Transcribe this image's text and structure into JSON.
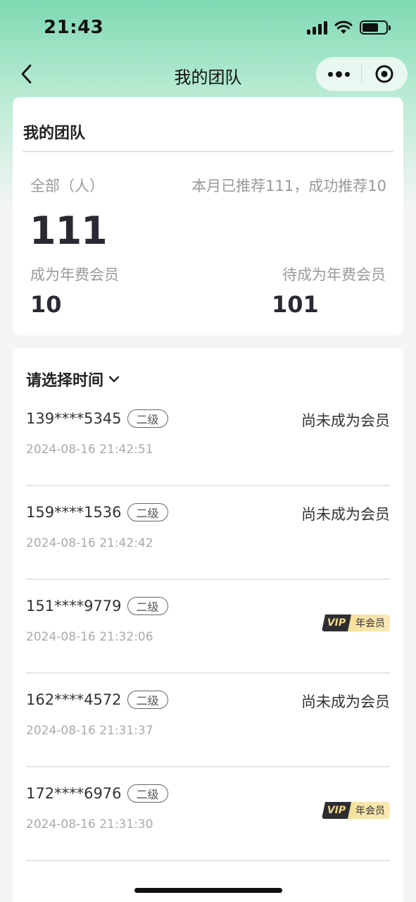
{
  "status_bar": {
    "time": "21:43"
  },
  "nav": {
    "title": "我的团队"
  },
  "summary": {
    "title": "我的团队",
    "all_label": "全部（人）",
    "month_text": "本月已推荐111，成功推荐10",
    "total": "111",
    "member_label": "成为年费会员",
    "member_count": "10",
    "pending_label": "待成为年费会员",
    "pending_count": "101"
  },
  "list": {
    "filter_label": "请选择时间",
    "rows": [
      {
        "phone": "139****5345",
        "level": "二级",
        "date": "2024-08-16 21:42:51",
        "status": "尚未成为会员",
        "vip": false
      },
      {
        "phone": "159****1536",
        "level": "二级",
        "date": "2024-08-16 21:42:42",
        "status": "尚未成为会员",
        "vip": false
      },
      {
        "phone": "151****9779",
        "level": "二级",
        "date": "2024-08-16 21:32:06",
        "status": "",
        "vip": true
      },
      {
        "phone": "162****4572",
        "level": "二级",
        "date": "2024-08-16 21:31:37",
        "status": "尚未成为会员",
        "vip": false
      },
      {
        "phone": "172****6976",
        "level": "二级",
        "date": "2024-08-16 21:31:30",
        "status": "",
        "vip": true
      }
    ],
    "vip_badge": {
      "left": "VIP",
      "right": "年会员"
    }
  },
  "colors": {
    "accent_green": "#7ed9b3",
    "vip_dark": "#2d2d33",
    "vip_gold": "#f5df9a"
  },
  "icons": [
    "back-arrow-icon",
    "more-dots-icon",
    "target-icon",
    "chevron-down-icon",
    "signal-icon",
    "wifi-icon",
    "battery-icon"
  ]
}
